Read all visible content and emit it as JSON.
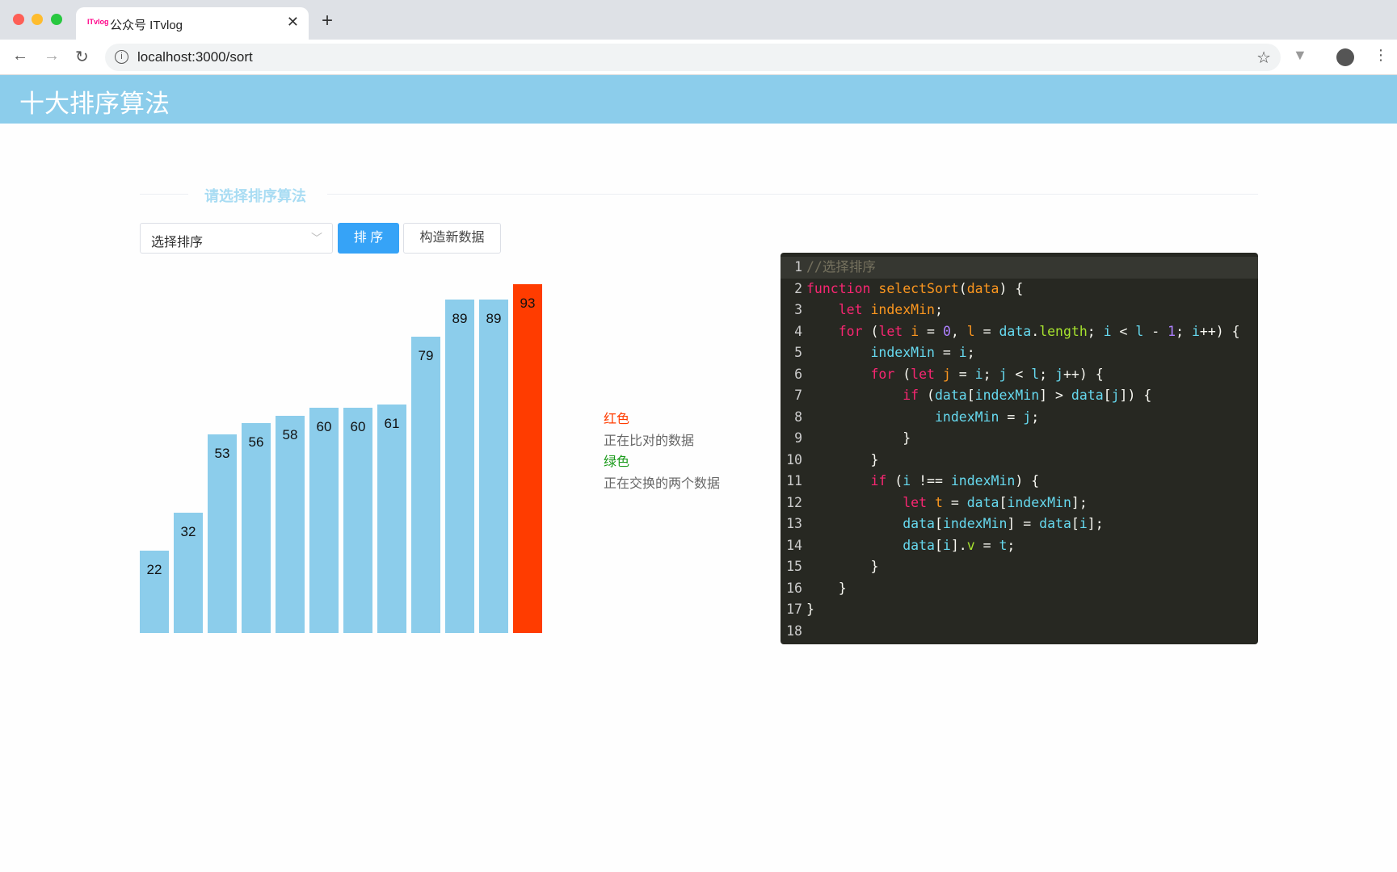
{
  "browser": {
    "tab_title": "公众号 ITvlog",
    "favicon_text": "ITvlog",
    "url": "localhost:3000/sort"
  },
  "header": {
    "title": "十大排序算法"
  },
  "section_label": "请选择排序算法",
  "controls": {
    "select_value": "选择排序",
    "sort_button": "排 序",
    "new_data_button": "构造新数据"
  },
  "legend": {
    "red_label": "红色",
    "red_desc": "正在比对的数据",
    "green_label": "绿色",
    "green_desc": "正在交换的两个数据",
    "red_color": "#ff3c00",
    "green_color": "#1a9a1a"
  },
  "chart_data": {
    "type": "bar",
    "values": [
      22,
      32,
      53,
      56,
      58,
      60,
      60,
      61,
      79,
      89,
      89,
      93
    ],
    "highlight": [
      11
    ],
    "bar_color": "#8ccdeb",
    "highlight_color": "#ff3c00",
    "ylim": [
      0,
      93
    ]
  },
  "code": [
    [
      [
        "cm",
        "//选择排序"
      ]
    ],
    [
      [
        "k",
        "function"
      ],
      [
        "t",
        " "
      ],
      [
        "o",
        "selectSort"
      ],
      [
        "t",
        "("
      ],
      [
        "o",
        "data"
      ],
      [
        "t",
        ") {"
      ]
    ],
    [
      [
        "t",
        "    "
      ],
      [
        "k",
        "let"
      ],
      [
        "t",
        " "
      ],
      [
        "o",
        "indexMin"
      ],
      [
        "t",
        ";"
      ]
    ],
    [
      [
        "t",
        "    "
      ],
      [
        "k",
        "for"
      ],
      [
        "t",
        " ("
      ],
      [
        "k",
        "let"
      ],
      [
        "t",
        " "
      ],
      [
        "o",
        "i"
      ],
      [
        "t",
        " = "
      ],
      [
        "p",
        "0"
      ],
      [
        "t",
        ", "
      ],
      [
        "o",
        "l"
      ],
      [
        "t",
        " = "
      ],
      [
        "c",
        "data"
      ],
      [
        "t",
        "."
      ],
      [
        "g",
        "length"
      ],
      [
        "t",
        "; "
      ],
      [
        "c",
        "i"
      ],
      [
        "t",
        " < "
      ],
      [
        "c",
        "l"
      ],
      [
        "t",
        " - "
      ],
      [
        "p",
        "1"
      ],
      [
        "t",
        "; "
      ],
      [
        "c",
        "i"
      ],
      [
        "t",
        "++) {"
      ]
    ],
    [
      [
        "t",
        "        "
      ],
      [
        "c",
        "indexMin"
      ],
      [
        "t",
        " = "
      ],
      [
        "c",
        "i"
      ],
      [
        "t",
        ";"
      ]
    ],
    [
      [
        "t",
        "        "
      ],
      [
        "k",
        "for"
      ],
      [
        "t",
        " ("
      ],
      [
        "k",
        "let"
      ],
      [
        "t",
        " "
      ],
      [
        "o",
        "j"
      ],
      [
        "t",
        " = "
      ],
      [
        "c",
        "i"
      ],
      [
        "t",
        "; "
      ],
      [
        "c",
        "j"
      ],
      [
        "t",
        " < "
      ],
      [
        "c",
        "l"
      ],
      [
        "t",
        "; "
      ],
      [
        "c",
        "j"
      ],
      [
        "t",
        "++) {"
      ]
    ],
    [
      [
        "t",
        "            "
      ],
      [
        "k",
        "if"
      ],
      [
        "t",
        " ("
      ],
      [
        "c",
        "data"
      ],
      [
        "t",
        "["
      ],
      [
        "c",
        "indexMin"
      ],
      [
        "t",
        "] > "
      ],
      [
        "c",
        "data"
      ],
      [
        "t",
        "["
      ],
      [
        "c",
        "j"
      ],
      [
        "t",
        "]) {"
      ]
    ],
    [
      [
        "t",
        "                "
      ],
      [
        "c",
        "indexMin"
      ],
      [
        "t",
        " = "
      ],
      [
        "c",
        "j"
      ],
      [
        "t",
        ";"
      ]
    ],
    [
      [
        "t",
        "            }"
      ]
    ],
    [
      [
        "t",
        "        }"
      ]
    ],
    [
      [
        "t",
        "        "
      ],
      [
        "k",
        "if"
      ],
      [
        "t",
        " ("
      ],
      [
        "c",
        "i"
      ],
      [
        "t",
        " !== "
      ],
      [
        "c",
        "indexMin"
      ],
      [
        "t",
        ") {"
      ]
    ],
    [
      [
        "t",
        "            "
      ],
      [
        "k",
        "let"
      ],
      [
        "t",
        " "
      ],
      [
        "o",
        "t"
      ],
      [
        "t",
        " = "
      ],
      [
        "c",
        "data"
      ],
      [
        "t",
        "["
      ],
      [
        "c",
        "indexMin"
      ],
      [
        "t",
        "];"
      ]
    ],
    [
      [
        "t",
        "            "
      ],
      [
        "c",
        "data"
      ],
      [
        "t",
        "["
      ],
      [
        "c",
        "indexMin"
      ],
      [
        "t",
        "] = "
      ],
      [
        "c",
        "data"
      ],
      [
        "t",
        "["
      ],
      [
        "c",
        "i"
      ],
      [
        "t",
        "];"
      ]
    ],
    [
      [
        "t",
        "            "
      ],
      [
        "c",
        "data"
      ],
      [
        "t",
        "["
      ],
      [
        "c",
        "i"
      ],
      [
        "t",
        "]."
      ],
      [
        "g",
        "v"
      ],
      [
        "t",
        " = "
      ],
      [
        "c",
        "t"
      ],
      [
        "t",
        ";"
      ]
    ],
    [
      [
        "t",
        "        }"
      ]
    ],
    [
      [
        "t",
        "    }"
      ]
    ],
    [
      [
        "t",
        "}"
      ]
    ],
    []
  ]
}
